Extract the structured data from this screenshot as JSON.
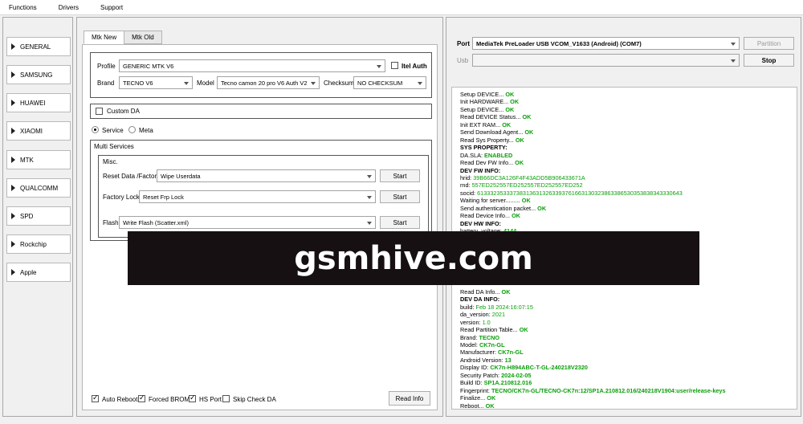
{
  "menu": [
    "Functions",
    "Drivers",
    "Support"
  ],
  "brands": [
    "GENERAL",
    "SAMSUNG",
    "HUAWEI",
    "XIAOMI",
    "MTK",
    "QUALCOMM",
    "SPD",
    "Rockchip",
    "Apple"
  ],
  "tabs": [
    "Mtk New",
    "Mtk Old"
  ],
  "device": {
    "profile_label": "Profile",
    "profile_value": "GENERIC MTK V6",
    "itel_auth": "Itel Auth",
    "brand_label": "Brand",
    "brand_value": "TECNO V6",
    "model_label": "Model",
    "model_value": "Tecno camon 20 pro V6 Auth V2",
    "checksum_label": "Checksum",
    "checksum_value": "NO CHECKSUM"
  },
  "custom_da": "Custom DA",
  "mode": {
    "service": "Service",
    "meta": "Meta"
  },
  "multi_services": {
    "title": "Multi Services",
    "misc": "Misc.",
    "rows": [
      {
        "label": "Reset Data /Factory",
        "value": "Wipe Userdata",
        "button": "Start"
      },
      {
        "label": "Factory Lock",
        "value": "Reset Frp Lock",
        "button": "Start"
      },
      {
        "label": "Flash",
        "value": "Write Flash (Scatter.xml)",
        "button": "Start"
      }
    ]
  },
  "bottom": {
    "auto_reboot": "Auto Reboot",
    "forced_brom": "Forced BROM",
    "hs_port": "HS Port",
    "skip_check_da": "Skip Check DA",
    "read_info": "Read Info"
  },
  "port": {
    "port_label": "Port",
    "port_value": "MediaTek PreLoader USB VCOM_V1633 (Android) (COM7)",
    "usb_label": "Usb",
    "partition_button": "Partition",
    "stop_button": "Stop"
  },
  "log": [
    {
      "k": "Setup DEVICE... ",
      "v": "OK"
    },
    {
      "k": "Init HARDWARE... ",
      "v": "OK"
    },
    {
      "k": "Setup DEVICE... ",
      "v": "OK"
    },
    {
      "k": "Read DEVICE Status... ",
      "v": "OK"
    },
    {
      "k": "Init EXT RAM... ",
      "v": "OK"
    },
    {
      "k": "Send Download Agent... ",
      "v": "OK"
    },
    {
      "k": "Read Sys Property... ",
      "v": "OK"
    },
    {
      "k": "SYS PROPERTY:",
      "v": "",
      "bold": true
    },
    {
      "k": "DA.SLA: ",
      "v": "ENABLED"
    },
    {
      "k": "Read Dev FW Info... ",
      "v": "OK"
    },
    {
      "k": "DEV FW INFO:",
      "v": "",
      "bold": true
    },
    {
      "k": "hrid: ",
      "v": "39B66DC3A126F4F43ADD5B906433671A",
      "s": true
    },
    {
      "k": "rnd: ",
      "v": "557ED252557ED252557ED252557ED252",
      "s": true
    },
    {
      "k": "socid: ",
      "v": "613332353337383136313263393761663130323863386530353838343330643",
      "s": true
    },
    {
      "k": "Waiting for server......... ",
      "v": "OK"
    },
    {
      "k": "Send authentication packet... ",
      "v": "OK"
    },
    {
      "k": "Read Device Info... ",
      "v": "OK"
    },
    {
      "k": "DEV HW INFO:",
      "v": "",
      "bold": true
    },
    {
      "k": "battery_voltage: ",
      "v": "4144"
    },
    {
      "k": "",
      "v": ""
    },
    {
      "k": "",
      "v": ""
    },
    {
      "k": "",
      "v": ""
    },
    {
      "k": "",
      "v": ""
    },
    {
      "k": "",
      "v": ""
    },
    {
      "k": "",
      "v": ""
    },
    {
      "k": "",
      "v": ""
    },
    {
      "k": "Read DA Info... ",
      "v": "OK"
    },
    {
      "k": "DEV DA INFO:",
      "v": "",
      "bold": true
    },
    {
      "k": "build: ",
      "v": "Feb 18 2024:16:07:15",
      "s": true
    },
    {
      "k": "da_version: ",
      "v": "2021",
      "s": true
    },
    {
      "k": "version: ",
      "v": "1.0",
      "s": true
    },
    {
      "k": "Read Partition Table... ",
      "v": "OK"
    },
    {
      "k": " Brand: ",
      "v": "TECNO"
    },
    {
      "k": " Model: ",
      "v": "CK7n-GL"
    },
    {
      "k": " Manufacturer: ",
      "v": "CK7n-GL"
    },
    {
      "k": "Android Version: ",
      "v": "13"
    },
    {
      "k": "Display ID: ",
      "v": "CK7n-H894ABC-T-GL-240218V2320"
    },
    {
      "k": "Security Patch: ",
      "v": "2024-02-05"
    },
    {
      "k": "Build ID: ",
      "v": "SP1A.210812.016"
    },
    {
      "k": "Fingerprint: ",
      "v": "TECNO/CK7n-GL/TECNO-CK7n:12/SP1A.210812.016/240218V1904:user/release-keys"
    },
    {
      "k": "Finalize... ",
      "v": "OK"
    },
    {
      "k": "Reboot... ",
      "v": "OK"
    }
  ],
  "watermark": "gsmhive.com"
}
